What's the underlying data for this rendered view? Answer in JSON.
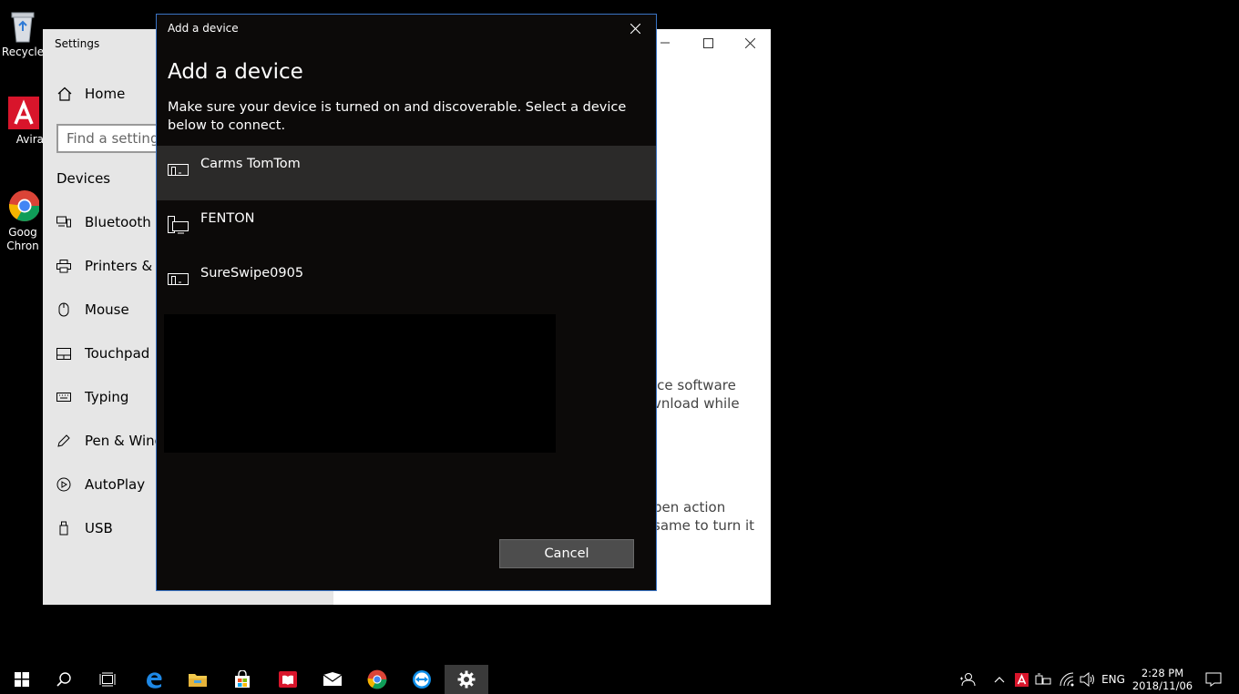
{
  "desktop": {
    "icons": [
      {
        "label": "Recycle"
      },
      {
        "label": "Avira"
      },
      {
        "label": "Goog\nChron"
      }
    ]
  },
  "settings": {
    "title": "Settings",
    "home_label": "Home",
    "search_placeholder": "Find a setting",
    "section": "Devices",
    "nav": [
      {
        "label": "Bluetooth &",
        "icon": "bluetooth-devices-icon"
      },
      {
        "label": "Printers & sc",
        "icon": "printer-icon"
      },
      {
        "label": "Mouse",
        "icon": "mouse-icon"
      },
      {
        "label": "Touchpad",
        "icon": "touchpad-icon"
      },
      {
        "label": "Typing",
        "icon": "keyboard-icon"
      },
      {
        "label": "Pen & Wind",
        "icon": "pen-icon"
      },
      {
        "label": "AutoPlay",
        "icon": "autoplay-icon"
      },
      {
        "label": "USB",
        "icon": "usb-icon"
      }
    ],
    "bg_text": [
      {
        "line1": "ice software",
        "line2": "vnload while"
      },
      {
        "line1": "pen action",
        "line2": "same to turn it"
      }
    ]
  },
  "dialog": {
    "window_title": "Add a device",
    "heading": "Add a device",
    "description": "Make sure your device is turned on and discoverable. Select a device below to connect.",
    "devices": [
      {
        "name": "Carms TomTom",
        "icon": "display-device-icon",
        "selected": true
      },
      {
        "name": "FENTON",
        "icon": "computer-device-icon",
        "selected": false
      },
      {
        "name": "SureSwipe0905",
        "icon": "display-device-icon",
        "selected": false
      }
    ],
    "cancel_label": "Cancel"
  },
  "taskbar": {
    "language": "ENG",
    "time": "2:28 PM",
    "date": "2018/11/06"
  },
  "colors": {
    "dialog_bg": "#0c0a09",
    "dialog_border": "#3a74c5",
    "selected_row": "#2b2a29",
    "cancel_bg": "#4d4d4d",
    "sidebar_bg": "#e6e6e6"
  }
}
